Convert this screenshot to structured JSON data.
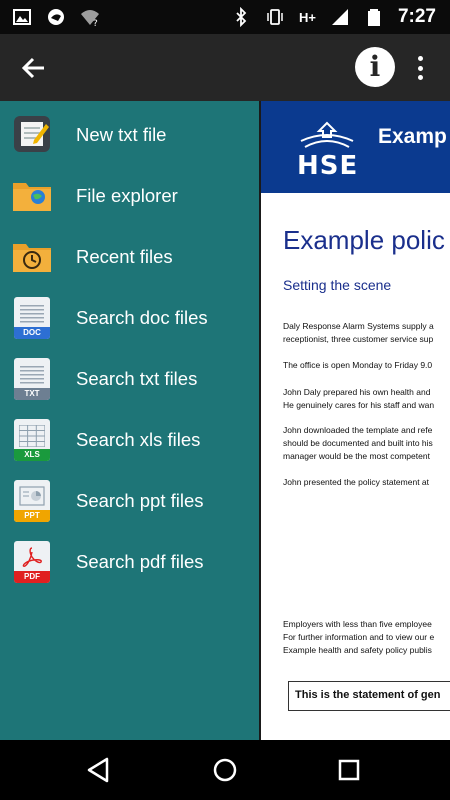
{
  "status_bar": {
    "time": "7:27",
    "network": "H+",
    "icons": [
      "image-icon",
      "circle-logo-icon",
      "wifi-question-icon",
      "bluetooth-icon",
      "vibrate-icon",
      "signal-icon",
      "battery-icon"
    ]
  },
  "app_bar": {
    "back_icon": "arrow-back-icon",
    "info_label": "i",
    "menu_icon": "more-vert-icon"
  },
  "drawer": {
    "items": [
      {
        "label": "New txt file",
        "icon": "notepad-icon"
      },
      {
        "label": "File explorer",
        "icon": "folder-globe-icon"
      },
      {
        "label": "Recent files",
        "icon": "folder-history-icon"
      },
      {
        "label": "Search doc files",
        "icon": "doc-file-icon",
        "tag": "DOC",
        "tag_color": "#2d6fd3"
      },
      {
        "label": "Search txt files",
        "icon": "txt-file-icon",
        "tag": "TXT",
        "tag_color": "#6d7f92"
      },
      {
        "label": "Search xls files",
        "icon": "xls-file-icon",
        "tag": "XLS",
        "tag_color": "#1a9a3d"
      },
      {
        "label": "Search ppt files",
        "icon": "ppt-file-icon",
        "tag": "PPT",
        "tag_color": "#f0a500"
      },
      {
        "label": "Search pdf files",
        "icon": "pdf-file-icon",
        "tag": "PDF",
        "tag_color": "#e02020"
      }
    ]
  },
  "document": {
    "banner_title": "Examp",
    "logo_text": "HSE",
    "title": "Example polic",
    "subtitle": "Setting the scene",
    "lines": [
      "Daly Response Alarm Systems supply a",
      "receptionist, three customer service sup",
      "The office is open Monday to Friday 9.0",
      "John Daly prepared his own health and",
      "He genuinely cares for his staff and wan",
      "John downloaded the template and refe",
      "should be documented and built into his",
      "manager would be the most competent",
      "John presented the policy statement at",
      "Employers with less than five employee",
      "For further information and to view our e",
      "Example health and safety policy publis"
    ],
    "statement": "This is the statement of gen"
  },
  "nav_bar": {
    "icons": [
      "back-triangle-icon",
      "home-circle-icon",
      "recents-square-icon"
    ]
  },
  "colors": {
    "drawer_bg": "#1e7577",
    "app_bar_bg": "#262626",
    "banner_bg": "#0b3a8f",
    "title_blue": "#1a2f8c"
  }
}
